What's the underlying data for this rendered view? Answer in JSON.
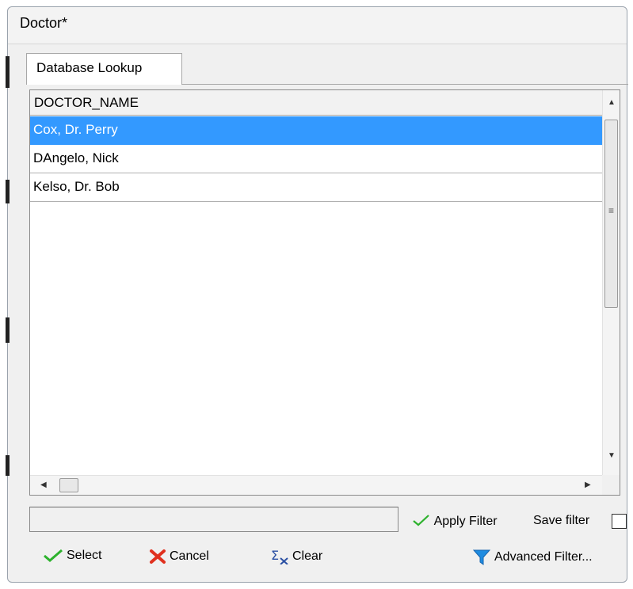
{
  "window": {
    "title": "Doctor*"
  },
  "tab": {
    "label": "Database Lookup"
  },
  "grid": {
    "column_header": "DOCTOR_NAME",
    "rows": [
      "Cox, Dr. Perry",
      "DAngelo, Nick",
      "Kelso, Dr. Bob"
    ],
    "selected_index": 0
  },
  "filter": {
    "input_value": "",
    "apply_label": "Apply Filter",
    "save_label": "Save filter",
    "save_checked": false
  },
  "buttons": {
    "select": "Select",
    "cancel": "Cancel",
    "clear": "Clear",
    "advanced": "Advanced Filter..."
  },
  "colors": {
    "selection": "#3399ff",
    "check_green": "#2db22d",
    "cancel_red": "#e0301e",
    "filter_blue": "#1e8be0"
  }
}
